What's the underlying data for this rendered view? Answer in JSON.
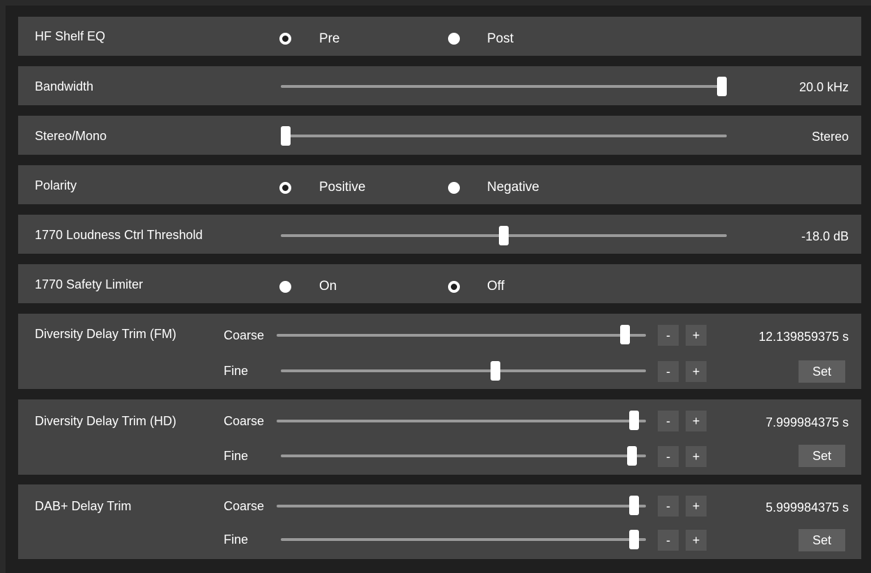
{
  "hf_shelf_eq": {
    "label": "HF Shelf EQ",
    "options": [
      "Pre",
      "Post"
    ],
    "selected": "Pre"
  },
  "bandwidth": {
    "label": "Bandwidth",
    "value_text": "20.0 kHz",
    "level": 1.0
  },
  "stereo_mono": {
    "label": "Stereo/Mono",
    "value_text": "Stereo",
    "level": 0.0
  },
  "polarity": {
    "label": "Polarity",
    "options": [
      "Positive",
      "Negative"
    ],
    "selected": "Positive"
  },
  "loudness_threshold": {
    "label": "1770 Loudness Ctrl Threshold",
    "value_text": "-18.0 dB",
    "level": 0.5
  },
  "safety_limiter": {
    "label": "1770 Safety Limiter",
    "options": [
      "On",
      "Off"
    ],
    "selected": "Off"
  },
  "delay_groups": [
    {
      "label": "Diversity Delay Trim (FM)",
      "coarse_label": "Coarse",
      "fine_label": "Fine",
      "value_text": "12.139859375 s",
      "coarse_level": 0.955,
      "fine_level": 0.59,
      "minus": "-",
      "plus": "+",
      "set_label": "Set"
    },
    {
      "label": "Diversity Delay Trim (HD)",
      "coarse_label": "Coarse",
      "fine_label": "Fine",
      "value_text": "7.999984375 s",
      "coarse_level": 0.98,
      "fine_level": 0.975,
      "minus": "-",
      "plus": "+",
      "set_label": "Set"
    },
    {
      "label": "DAB+ Delay Trim",
      "coarse_label": "Coarse",
      "fine_label": "Fine",
      "value_text": "5.999984375 s",
      "coarse_level": 0.98,
      "fine_level": 0.98,
      "minus": "-",
      "plus": "+",
      "set_label": "Set"
    }
  ],
  "colors": {
    "panel_bg": "#444444",
    "frame_bg": "#1f1f1f",
    "track": "#9a9a9a",
    "thumb": "#ffffff",
    "button": "#555555"
  }
}
